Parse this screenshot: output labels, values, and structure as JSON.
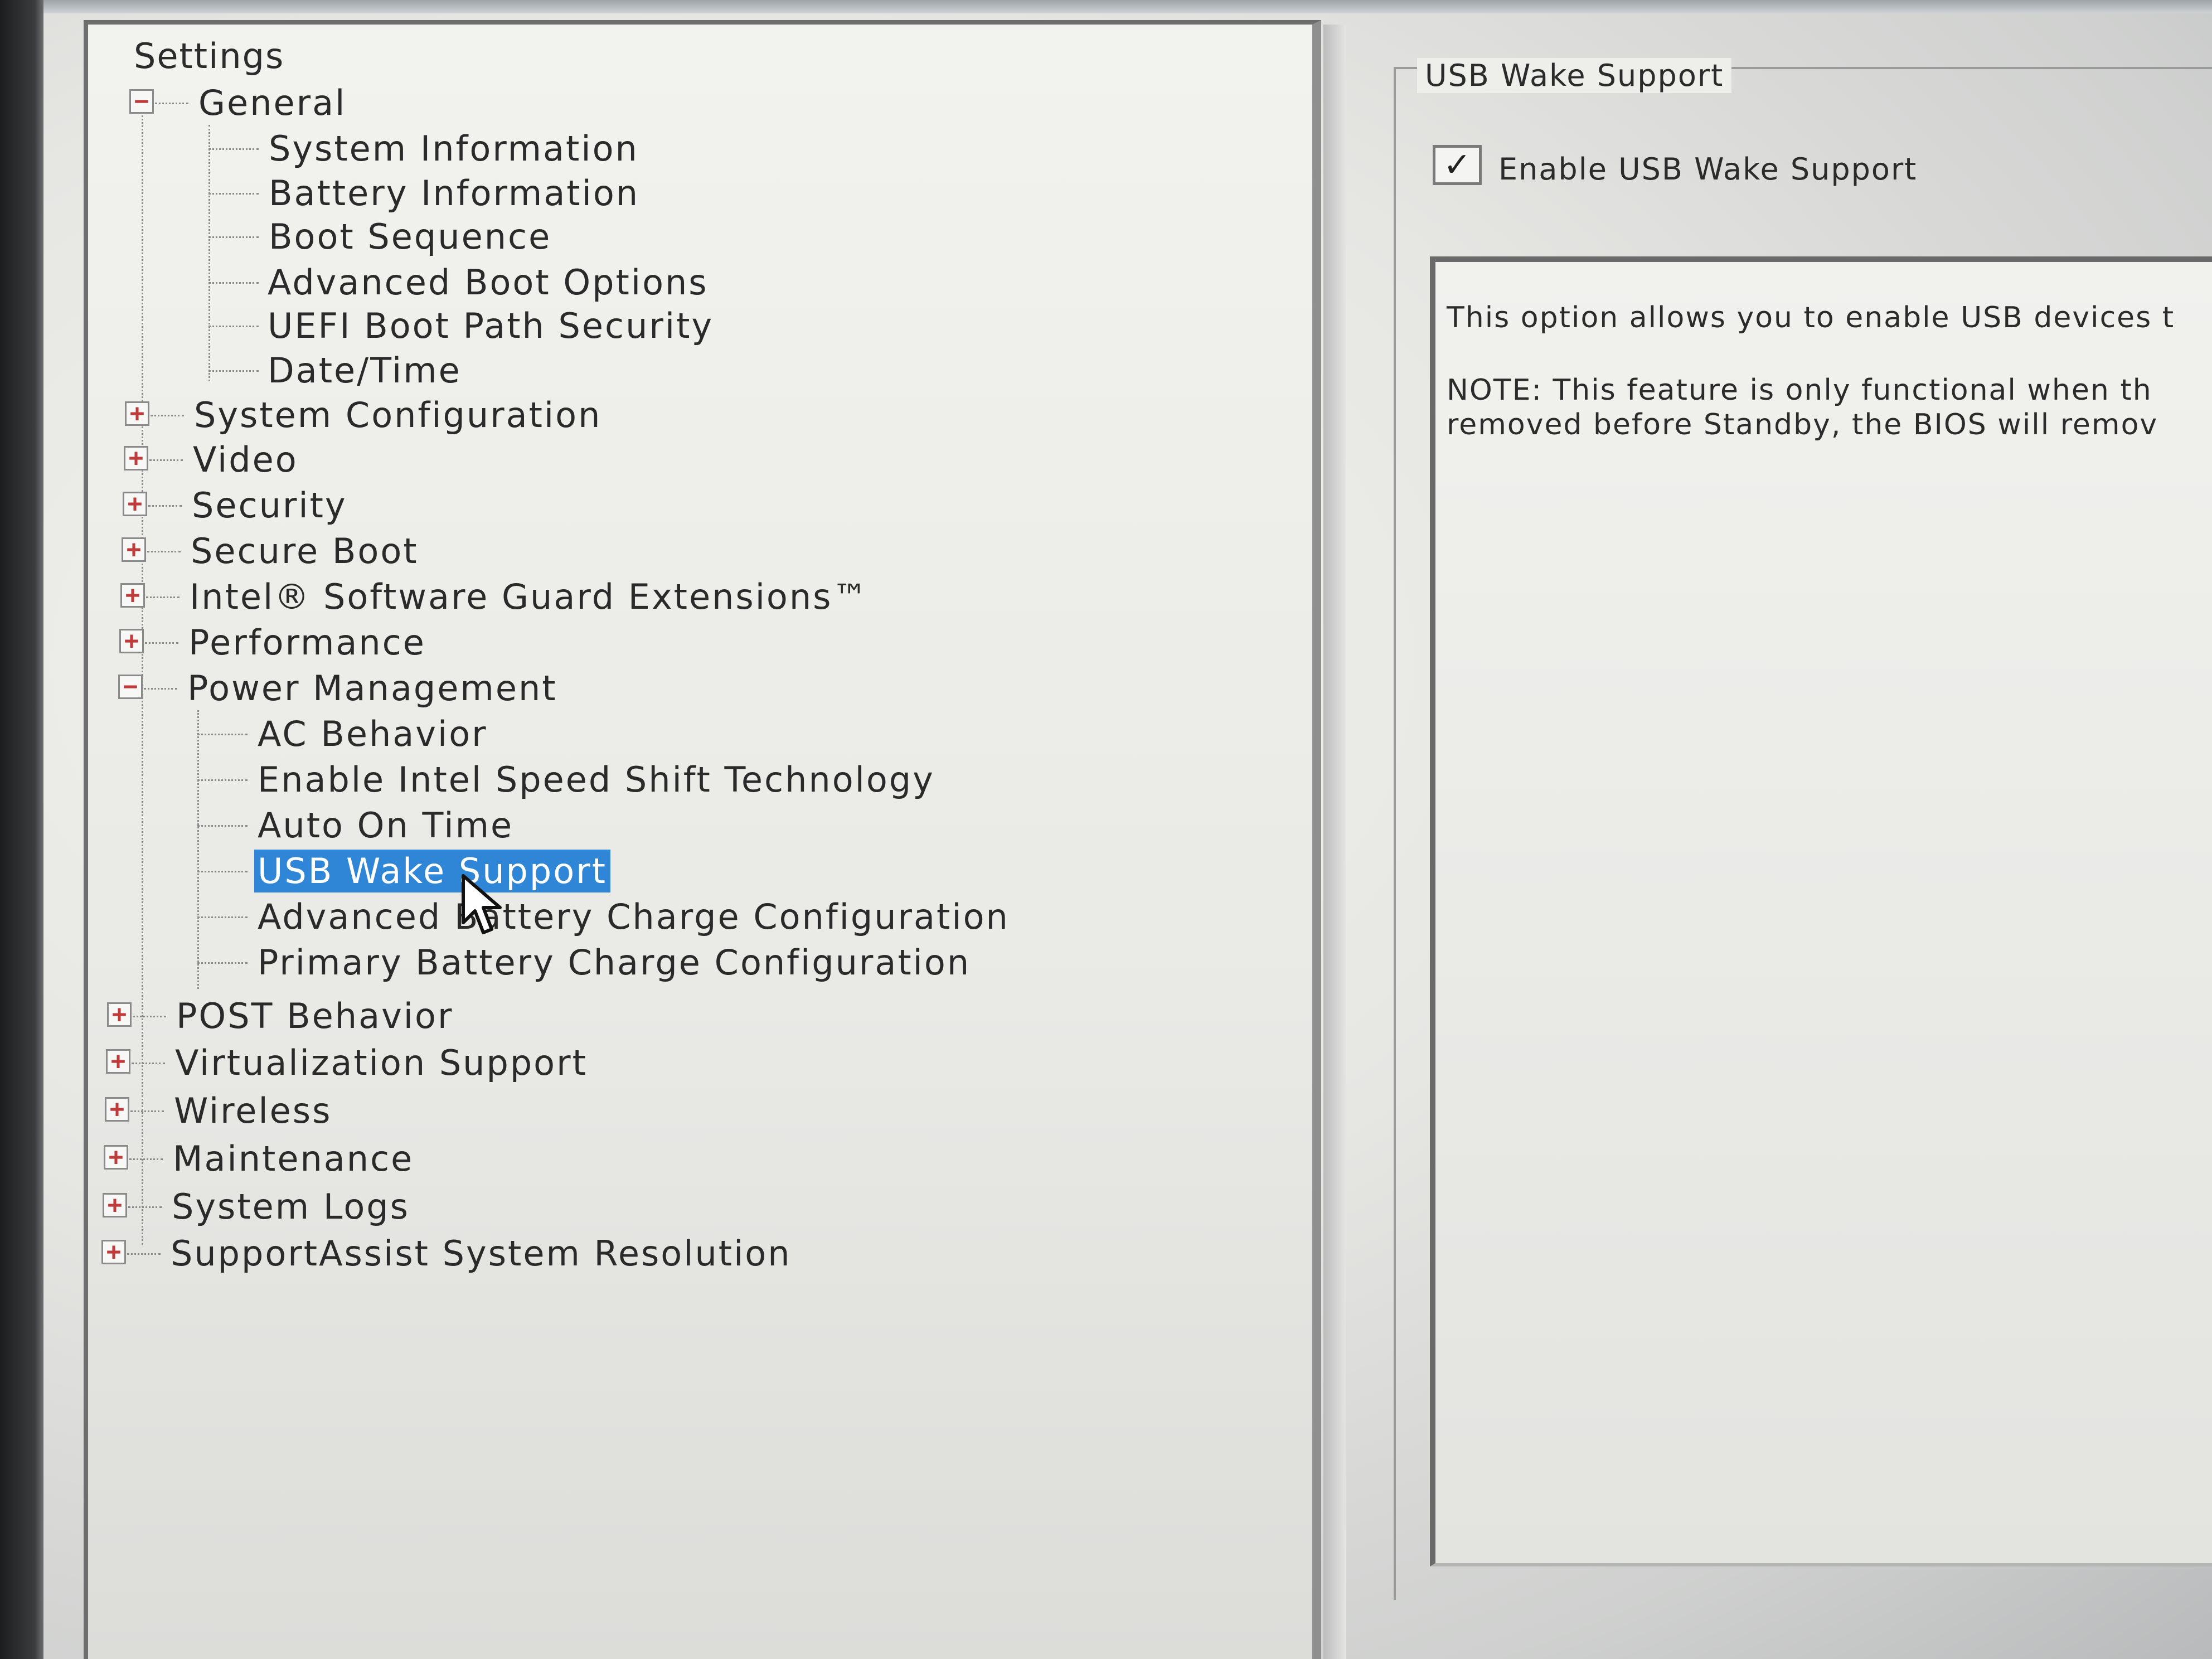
{
  "tree": {
    "root": "Settings",
    "groups": [
      {
        "label": "General",
        "expanded": true,
        "children": [
          "System Information",
          "Battery Information",
          "Boot Sequence",
          "Advanced Boot Options",
          "UEFI Boot Path Security",
          "Date/Time"
        ]
      },
      {
        "label": "System Configuration",
        "expanded": false
      },
      {
        "label": "Video",
        "expanded": false
      },
      {
        "label": "Security",
        "expanded": false
      },
      {
        "label": "Secure Boot",
        "expanded": false
      },
      {
        "label": "Intel® Software Guard Extensions™",
        "expanded": false
      },
      {
        "label": "Performance",
        "expanded": false
      },
      {
        "label": "Power Management",
        "expanded": true,
        "children": [
          "AC Behavior",
          "Enable Intel Speed Shift Technology",
          "Auto On Time",
          "USB Wake Support",
          "Advanced Battery Charge Configuration",
          "Primary Battery Charge Configuration"
        ]
      },
      {
        "label": "POST Behavior",
        "expanded": false
      },
      {
        "label": "Virtualization Support",
        "expanded": false
      },
      {
        "label": "Wireless",
        "expanded": false
      },
      {
        "label": "Maintenance",
        "expanded": false
      },
      {
        "label": "System Logs",
        "expanded": false
      },
      {
        "label": "SupportAssist System Resolution",
        "expanded": false
      }
    ],
    "selected": "USB Wake Support",
    "expanded_glyph": "−",
    "collapsed_glyph": "+"
  },
  "detail": {
    "group_title": "USB Wake Support",
    "checkbox": {
      "label": "Enable USB Wake Support",
      "checked": true,
      "check_glyph": "✓"
    },
    "help_lines": [
      "This option allows you to enable USB devices t",
      "NOTE: This feature is only functional when th",
      "removed before Standby, the BIOS will remov"
    ]
  },
  "colors": {
    "selection": "#2f86d6",
    "expander_glyph": "#c03a3a"
  },
  "icons": {
    "cursor": "arrow-pointer-icon",
    "checkbox": "checkmark-icon"
  }
}
